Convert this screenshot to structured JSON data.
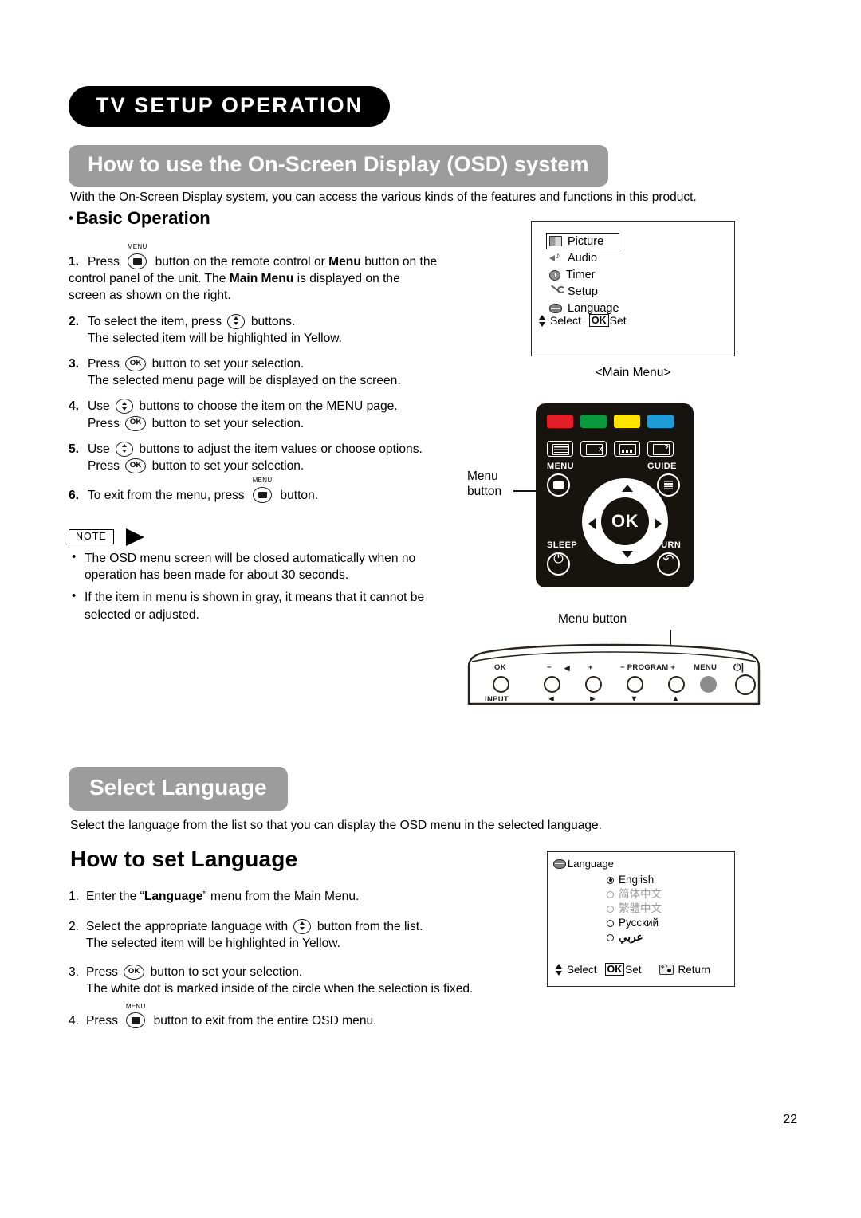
{
  "page": {
    "chapter_title": "TV SETUP OPERATION",
    "page_number": "22"
  },
  "section_osd": {
    "band_title": "How to use the On-Screen Display (OSD) system",
    "intro": "With the On-Screen Display system, you can access the various kinds of the features and functions in this product.",
    "subheading_bullet": "•",
    "subheading": "Basic Operation",
    "steps": [
      {
        "num": "1.",
        "pre": "Press",
        "icon": "menu-key-icon",
        "text_a": "button on the remote control or ",
        "bold_a": "Menu",
        "text_b": " button on the",
        "line2_a": "control panel of the unit. The ",
        "line2_bold": "Main Menu",
        "line2_b": " is displayed on the",
        "line3": "screen as shown on the right."
      },
      {
        "num": "2.",
        "pre": "To select the item, press",
        "icon": "updown-key-icon",
        "post": "buttons.",
        "cont": "The selected item will be highlighted in Yellow."
      },
      {
        "num": "3.",
        "pre": "Press",
        "icon": "ok-key-icon",
        "post": "button to set your selection.",
        "cont": "The selected menu page will be displayed on the screen."
      },
      {
        "num": "4.",
        "pre": "Use",
        "icon": "updown-key-icon",
        "post": "buttons to choose the item on the MENU page.",
        "cont_pre": "Press",
        "cont_icon": "ok-key-icon",
        "cont_post": "button to set your selection."
      },
      {
        "num": "5.",
        "pre": "Use",
        "icon": "updown-key-icon",
        "post": "buttons to adjust the item values or choose options.",
        "cont_pre": "Press",
        "cont_icon": "ok-key-icon",
        "cont_post": "button to set your selection."
      },
      {
        "num": "6.",
        "pre": "To exit from the menu, press",
        "icon": "menu-key-icon",
        "post": "button."
      }
    ],
    "note": {
      "label": "NOTE",
      "items": [
        "The OSD menu screen will be closed automatically when no operation has been made for about 30 seconds.",
        "If the item in menu is shown in gray, it means that it cannot be selected or adjusted."
      ]
    }
  },
  "main_menu_osd": {
    "caption": "<Main Menu>",
    "items": [
      {
        "label": "Picture",
        "icon": "picture-icon",
        "selected": true
      },
      {
        "label": "Audio",
        "icon": "audio-icon",
        "selected": false
      },
      {
        "label": "Timer",
        "icon": "timer-icon",
        "selected": false
      },
      {
        "label": "Setup",
        "icon": "setup-icon",
        "selected": false
      },
      {
        "label": "Language",
        "icon": "language-icon",
        "selected": false
      }
    ],
    "hint_select": "Select",
    "hint_ok": "OK",
    "hint_set": "Set"
  },
  "remote": {
    "callout_line1": "Menu",
    "callout_line2": "button",
    "label_menu": "MENU",
    "label_guide": "GUIDE",
    "label_sleep": "SLEEP",
    "label_return": "RETURN",
    "ok_label": "OK",
    "colors": {
      "red": "#e21f26",
      "green": "#0a9a3d",
      "yellow": "#ffe400",
      "blue": "#1e9cd8"
    }
  },
  "control_panel": {
    "callout": "Menu button",
    "labels_top": [
      "OK",
      "−",
      "+",
      "− PROGRAM +",
      "MENU"
    ],
    "label_volume_minus": "−",
    "label_volume_plus": "+",
    "label_program": "− PROGRAM +",
    "label_ok": "OK",
    "label_menu": "MENU",
    "label_power": "⏻|",
    "label_input": "INPUT",
    "arrow_left": "◄",
    "arrow_right": "►",
    "arrow_down": "▼",
    "arrow_up": "▲"
  },
  "section_language": {
    "band_title": "Select Language",
    "intro": "Select the language from the list so that you can display the OSD menu in the selected language.",
    "heading": "How to set Language",
    "steps": [
      {
        "num": "1.",
        "text_a": "Enter the “",
        "bold": "Language",
        "text_b": "” menu from the Main Menu."
      },
      {
        "num": "2.",
        "pre": "Select the appropriate language with",
        "icon": "updown-key-icon",
        "post": "button from the list.",
        "cont": "The selected item will be highlighted in Yellow."
      },
      {
        "num": "3.",
        "pre": "Press",
        "icon": "ok-key-icon",
        "post": "button to set your selection.",
        "cont": "The white dot is marked inside of the circle when the selection is fixed."
      },
      {
        "num": "4.",
        "pre": "Press",
        "icon": "menu-key-icon",
        "post": "button to exit from the entire OSD menu."
      }
    ]
  },
  "language_osd": {
    "title": "Language",
    "options": [
      {
        "label": "English",
        "selected": true,
        "disabled": false,
        "rtl": false
      },
      {
        "label": "简体中文",
        "selected": false,
        "disabled": true,
        "rtl": false
      },
      {
        "label": "繁體中文",
        "selected": false,
        "disabled": true,
        "rtl": false
      },
      {
        "label": "Русский",
        "selected": false,
        "disabled": false,
        "rtl": false
      },
      {
        "label": "عربي",
        "selected": false,
        "disabled": false,
        "rtl": true
      }
    ],
    "hint_select": "Select",
    "hint_ok": "OK",
    "hint_set": "Set",
    "hint_return": "Return"
  }
}
